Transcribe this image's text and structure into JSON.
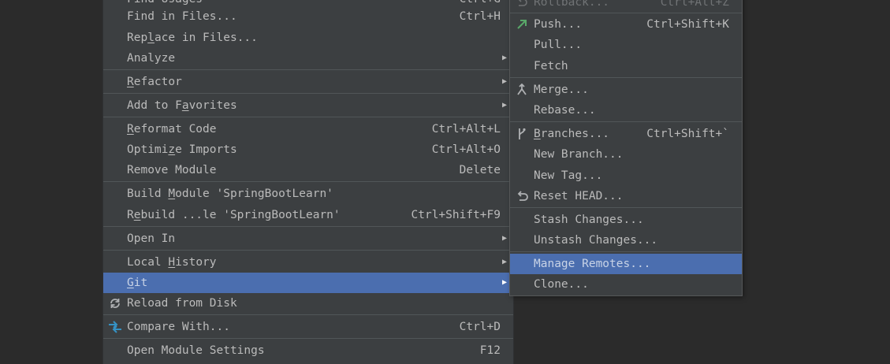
{
  "main_menu": {
    "find_usages": {
      "label": "Find Usages",
      "shortcut": "Ctrl+G"
    },
    "find_in_files": {
      "label": "Find in Files...",
      "shortcut": "Ctrl+H"
    },
    "replace_in_files": {
      "label_pre": "Rep",
      "label_u": "l",
      "label_post": "ace in Files..."
    },
    "analyze": {
      "label": "Analyze"
    },
    "refactor": {
      "label_u": "R",
      "label_post": "efactor"
    },
    "add_to_favorites": {
      "label_pre": "Add to F",
      "label_u": "a",
      "label_post": "vorites"
    },
    "reformat_code": {
      "label_u": "R",
      "label_post": "eformat Code",
      "shortcut": "Ctrl+Alt+L"
    },
    "optimize_imports": {
      "label_pre": "Optimi",
      "label_u": "z",
      "label_post": "e Imports",
      "shortcut": "Ctrl+Alt+O"
    },
    "remove_module": {
      "label": "Remove Module",
      "shortcut": "Delete"
    },
    "build_module": {
      "label_pre": "Build ",
      "label_u": "M",
      "label_post": "odule 'SpringBootLearn'"
    },
    "rebuild_module": {
      "label_pre": "R",
      "label_u": "e",
      "label_post": "build ...le 'SpringBootLearn'",
      "shortcut": "Ctrl+Shift+F9"
    },
    "open_in": {
      "label": "Open In"
    },
    "local_history": {
      "label_pre": "Local ",
      "label_u": "H",
      "label_post": "istory"
    },
    "git": {
      "label_u": "G",
      "label_post": "it"
    },
    "reload_from_disk": {
      "label": "Reload from Disk"
    },
    "compare_with": {
      "label": "Compare With...",
      "shortcut": "Ctrl+D"
    },
    "open_module_settings": {
      "label": "Open Module Settings",
      "shortcut": "F12"
    }
  },
  "git_menu": {
    "rollback": {
      "label": "Rollback...",
      "shortcut": "Ctrl+Alt+Z"
    },
    "push": {
      "label": "Push...",
      "shortcut": "Ctrl+Shift+K"
    },
    "pull": {
      "label": "Pull..."
    },
    "fetch": {
      "label": "Fetch"
    },
    "merge": {
      "label": "Merge..."
    },
    "rebase": {
      "label": "Rebase..."
    },
    "branches": {
      "label_u": "B",
      "label_post": "ranches...",
      "shortcut": "Ctrl+Shift+`"
    },
    "new_branch": {
      "label": "New Branch..."
    },
    "new_tag": {
      "label": "New Tag..."
    },
    "reset_head": {
      "label": "Reset HEAD..."
    },
    "stash_changes": {
      "label": "Stash Changes..."
    },
    "unstash_changes": {
      "label": "Unstash Changes..."
    },
    "manage_remotes": {
      "label": "Manage Remotes..."
    },
    "clone": {
      "label": "Clone..."
    }
  },
  "colors": {
    "menu_bg": "#3c3f41",
    "selection": "#4b6eaf",
    "push_icon": "#59a869",
    "compare_icon": "#3592c4"
  },
  "icons": [
    "rollback-icon",
    "push-icon",
    "merge-icon",
    "branches-icon",
    "reset-icon",
    "reload-icon",
    "compare-icon",
    "submenu-arrow-icon"
  ]
}
